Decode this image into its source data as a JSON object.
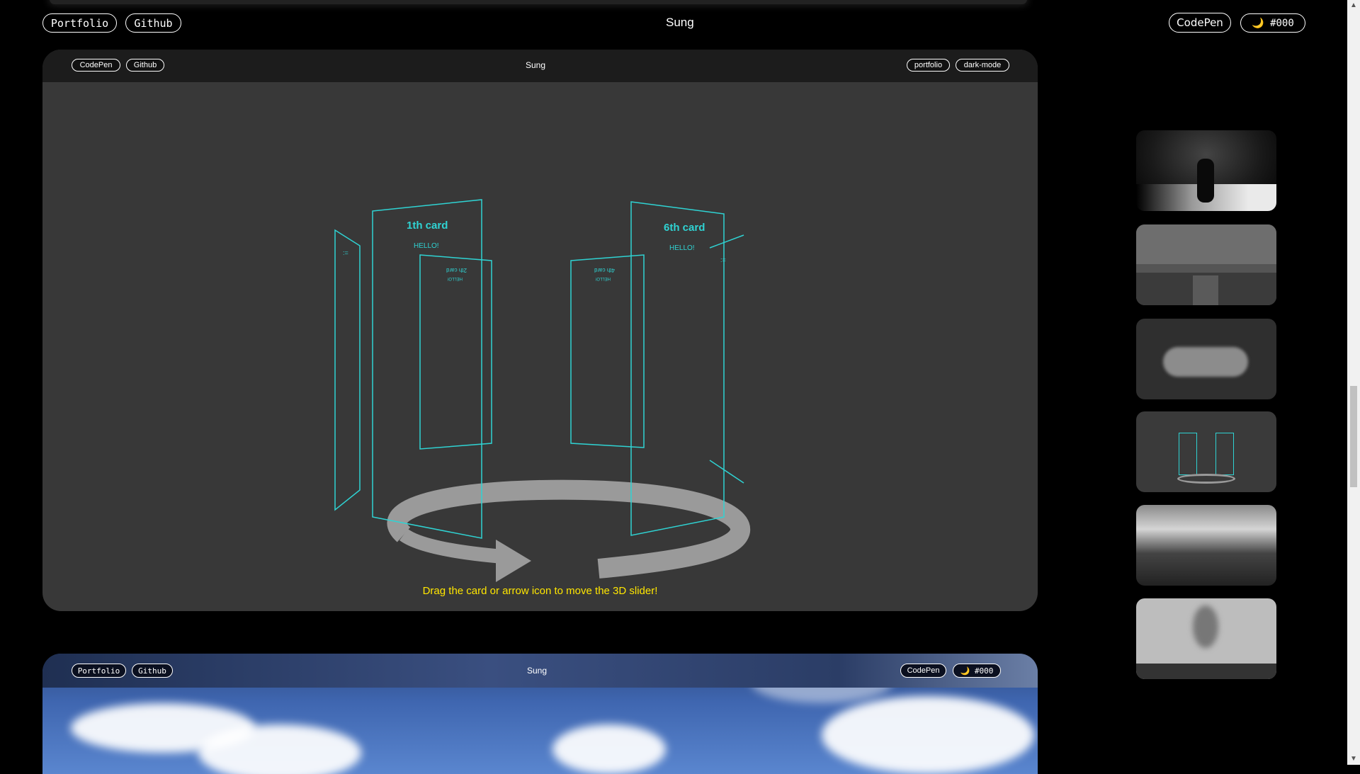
{
  "header": {
    "portfolio_label": "Portfolio",
    "github_label": "Github",
    "title": "Sung",
    "codepen_label": "CodePen",
    "theme_label": "🌙 #000"
  },
  "frame1": {
    "codepen_label": "CodePen",
    "github_label": "Github",
    "title": "Sung",
    "portfolio_label": "portfolio",
    "darkmode_label": "dark-mode",
    "cards": {
      "card1_title": "1th card",
      "card1_text": "HELLO!",
      "card6_title": "6th card",
      "card6_text": "HELLO!",
      "back_left_title": "2th card",
      "back_left_text": "HELLO!",
      "back_right_title": "4th card",
      "back_right_text": "HELLO!"
    },
    "hint": "Drag the card or arrow icon to move the 3D slider!"
  },
  "frame2": {
    "portfolio_label": "Portfolio",
    "github_label": "Github",
    "title": "Sung",
    "codepen_label": "CodePen",
    "theme_label": "🌙 #000"
  },
  "colors": {
    "background": "#000000",
    "frame": "#383838",
    "card_outline": "#2fd3d3",
    "hint": "#ffe600",
    "ring": "#9a9a9a"
  },
  "thumbnails": [
    "motorcycle-scene",
    "game-ui-scene",
    "cloud-text-scene",
    "3d-slider-scene",
    "sky-clouds-scene",
    "smoke-scene"
  ]
}
